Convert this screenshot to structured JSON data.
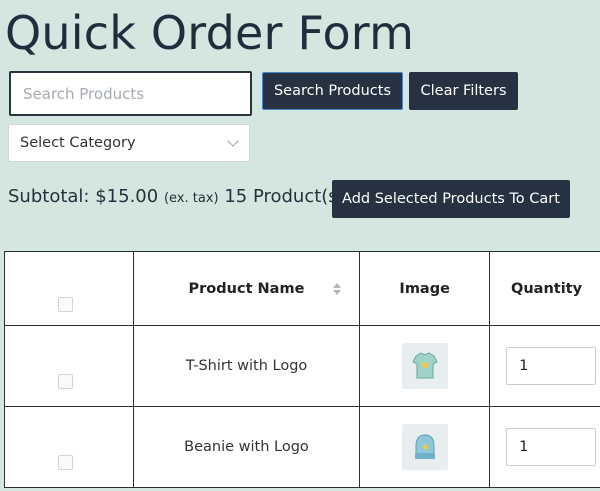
{
  "page": {
    "title": "Quick Order Form"
  },
  "filters": {
    "search_placeholder": "Search Products",
    "search_button": "Search Products",
    "clear_button": "Clear Filters",
    "category_selected": "Select Category"
  },
  "summary": {
    "subtotal_label": "Subtotal:",
    "subtotal_value": "$15.00",
    "tax_note": "(ex. tax)",
    "product_count": "15 Product(s)",
    "add_button": "Add Selected Products To Cart"
  },
  "table": {
    "headers": [
      "",
      "Product Name",
      "Image",
      "Quantity"
    ],
    "rows": [
      {
        "name": "T-Shirt with Logo",
        "image_icon": "tshirt-thumbnail",
        "quantity": "1"
      },
      {
        "name": "Beanie with Logo",
        "image_icon": "beanie-thumbnail",
        "quantity": "1"
      }
    ]
  },
  "colors": {
    "background": "#d4e6e0",
    "button": "#263241",
    "title": "#1f2d3d"
  }
}
